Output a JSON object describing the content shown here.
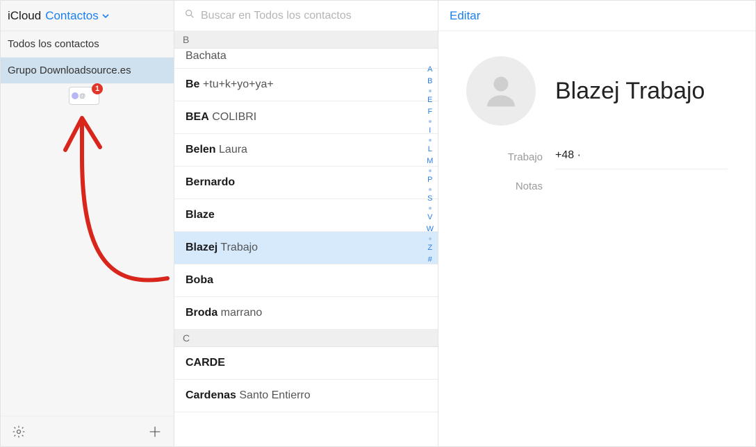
{
  "header": {
    "app": "iCloud",
    "menu": "Contactos"
  },
  "sidebar": {
    "items": [
      {
        "label": "Todos los contactos",
        "selected": false
      },
      {
        "label": "Grupo Downloadsource.es",
        "selected": true
      }
    ],
    "drag_badge": "1"
  },
  "search": {
    "placeholder": "Buscar en Todos los contactos"
  },
  "list": {
    "sections": [
      {
        "letter": "B",
        "rows": [
          {
            "bold": "",
            "rest": "Bachata",
            "cut": true
          },
          {
            "bold": "Be",
            "rest": " +tu+k+yo+ya+"
          },
          {
            "bold": "BEA",
            "rest": " COLIBRI"
          },
          {
            "bold": "Belen",
            "rest": " Laura"
          },
          {
            "bold": "Bernardo",
            "rest": ""
          },
          {
            "bold": "Blaze",
            "rest": ""
          },
          {
            "bold": "Blazej",
            "rest": " Trabajo",
            "selected": true
          },
          {
            "bold": "Boba",
            "rest": ""
          },
          {
            "bold": "Broda",
            "rest": " marrano"
          }
        ]
      },
      {
        "letter": "C",
        "rows": [
          {
            "bold": "CARDE",
            "rest": ""
          },
          {
            "bold": "Cardenas",
            "rest": " Santo Entierro"
          }
        ]
      }
    ],
    "alpha_index": [
      "A",
      "B",
      "•",
      "E",
      "F",
      "•",
      "I",
      "•",
      "L",
      "M",
      "•",
      "P",
      "•",
      "S",
      "•",
      "V",
      "W",
      "•",
      "Z",
      "#"
    ]
  },
  "detail": {
    "edit": "Editar",
    "name": "Blazej Trabajo",
    "phone": {
      "label": "Trabajo",
      "value": "+48     ·"
    },
    "notes_label": "Notas"
  }
}
